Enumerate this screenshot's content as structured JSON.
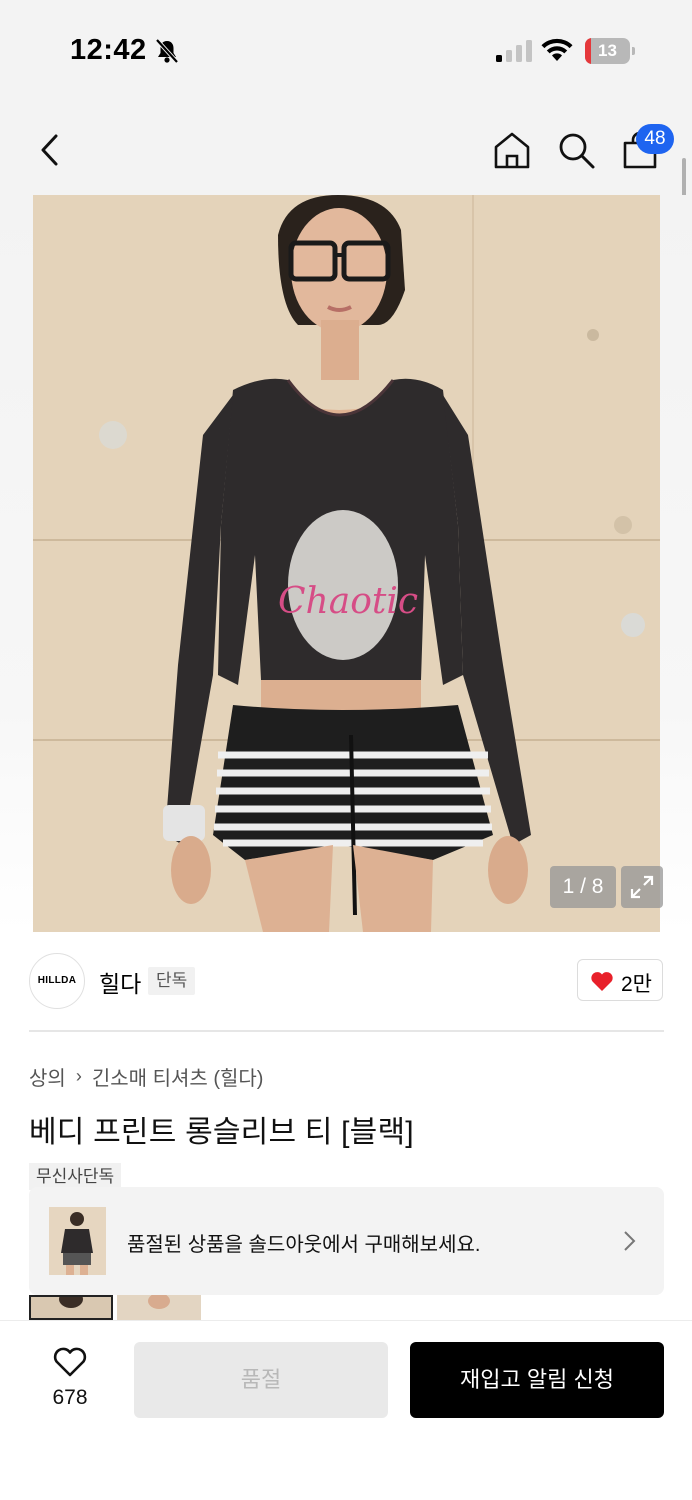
{
  "status_bar": {
    "time": "12:42",
    "battery_percent": 13,
    "battery_label": "13",
    "battery_color": "#e5383b"
  },
  "nav": {
    "back_icon": "chevron-left-icon",
    "home_icon": "home-icon",
    "search_icon": "search-icon",
    "cart_icon": "shopping-bag-icon",
    "cart_count": "48",
    "badge_color": "#1e64f0"
  },
  "gallery": {
    "counter": "1 / 8",
    "expand_icon": "expand-icon"
  },
  "brand": {
    "logo_text": "HILLDA",
    "name": "힐다",
    "exclusive_tag": "단독",
    "like_count": "2만"
  },
  "product": {
    "breadcrumb": [
      "상의",
      "긴소매 티셔츠 (힐다)"
    ],
    "title": "베디 프린트 롱슬리브 티 [블랙]",
    "badge": "무신사단독"
  },
  "soldout_banner": {
    "text": "품절된 상품을 솔드아웃에서 구매해보세요."
  },
  "bottom_bar": {
    "wish_count": "678",
    "soldout_label": "품절",
    "restock_label": "재입고 알림 신청"
  }
}
